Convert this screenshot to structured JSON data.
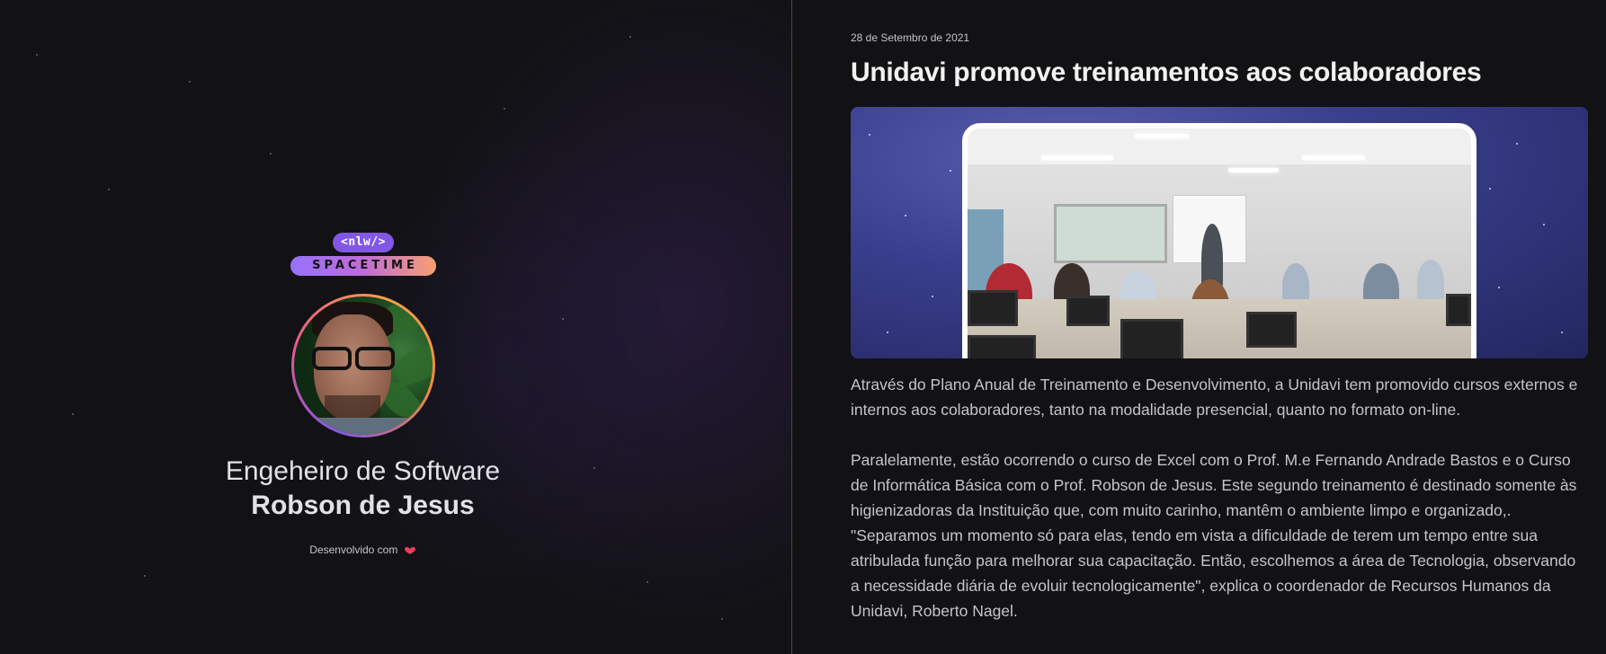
{
  "profile": {
    "logo_badge": "<nlw/>",
    "logo_wordmark": "SPACETIME",
    "role": "Engeheiro de Software",
    "name": "Robson de Jesus",
    "credit": "Desenvolvido com"
  },
  "post": {
    "date": "28 de Setembro de 2021",
    "title": "Unidavi promove treinamentos aos colaboradores",
    "paragraphs": [
      "Através do Plano Anual de Treinamento e Desenvolvimento, a Unidavi tem promovido cursos externos e internos aos colaboradores, tanto na modalidade presencial, quanto no formato on-line.",
      "Paralelamente, estão ocorrendo o curso de Excel com o Prof. M.e Fernando Andrade Bastos e o Curso de Informática Básica com o Prof. Robson de Jesus. Este segundo treinamento é destinado somente às higienizadoras da Instituição que, com muito carinho, mantêm o ambiente limpo e organizado,. \"Separamos um momento só para elas, tendo em vista a dificuldade de terem um tempo entre sua atribulada função para melhorar sua capacitação. Então, escolhemos a área de Tecnologia, observando a necessidade diária de evoluir tecnologicamente\", explica o coordenador de Recursos Humanos da Unidavi, Roberto Nagel."
    ]
  },
  "colors": {
    "background": "#121214",
    "brand_purple": "#8257e5",
    "brand_orange": "#f7a06f",
    "text_primary": "#e1e1e6",
    "text_secondary": "#c4c4cc"
  },
  "icons": {
    "heart": "heart-icon"
  }
}
